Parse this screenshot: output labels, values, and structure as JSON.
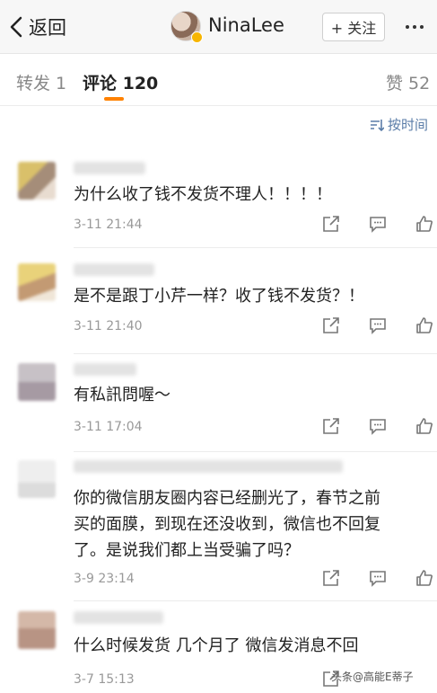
{
  "nav": {
    "back_label": "返回",
    "username": "NinaLee",
    "follow_label": "+ 关注"
  },
  "tabs": {
    "repost": "转发 1",
    "comment": "评论 120",
    "like": "赞 52",
    "sort_label": "按时间"
  },
  "comments": [
    {
      "text": "为什么收了钱不发货不理人！！！！",
      "time": "3-11 21:44"
    },
    {
      "text": "是不是跟丁小芹一样？收了钱不发货？！",
      "time": "3-11 21:40"
    },
    {
      "text": "有私訊問喔～",
      "time": "3-11 17:04"
    },
    {
      "text": "你的微信朋友圈内容已经删光了，春节之前\n买的面膜，到现在还没收到，微信也不回复\n了。是说我们都上当受骗了吗？",
      "time": "3-9 23:14"
    },
    {
      "text": "什么时候发货 几个月了 微信发消息不回",
      "time": "3-7 15:13"
    }
  ],
  "watermark": "头条@高能E蒂子",
  "colors": {
    "accent": "#ff8200",
    "link": "#5b7da8",
    "meta": "#999999"
  }
}
